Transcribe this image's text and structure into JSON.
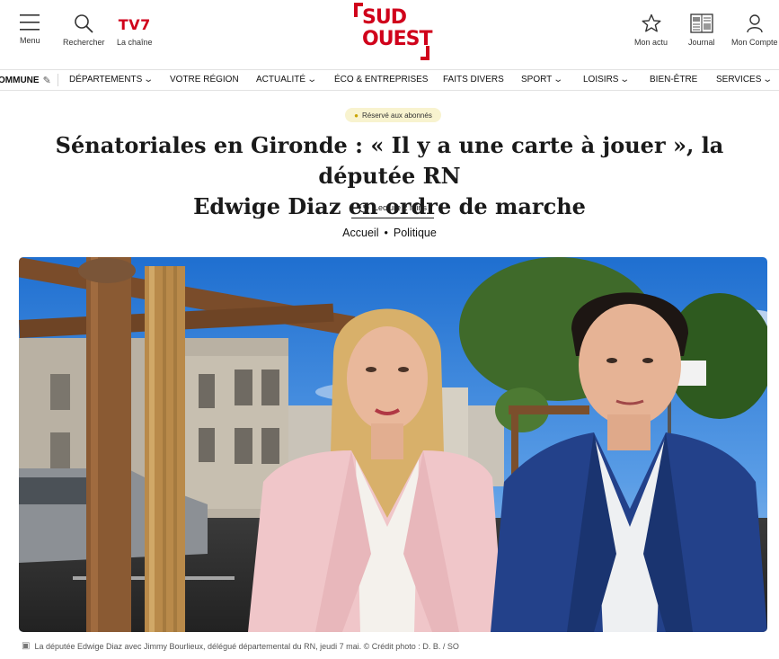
{
  "header": {
    "menu_label": "Menu",
    "search_label": "Rechercher",
    "channel_logo": "TV7",
    "channel_label": "La chaîne",
    "brand_line1": "SUD",
    "brand_line2": "OUEST",
    "brand_color": "#d0021b",
    "mon_actu_label": "Mon actu",
    "journal_label": "Journal",
    "compte_label": "Mon Compte"
  },
  "nav": {
    "items": [
      {
        "label": "OMMUNE",
        "has_chevron": false
      },
      {
        "label": "DÉPARTEMENTS",
        "has_chevron": true
      },
      {
        "label": "VOTRE RÉGION",
        "has_chevron": false
      },
      {
        "label": "ACTUALITÉ",
        "has_chevron": true
      },
      {
        "label": "ÉCO & ENTREPRISES",
        "has_chevron": false
      },
      {
        "label": "FAITS DIVERS",
        "has_chevron": false
      },
      {
        "label": "SPORT",
        "has_chevron": true
      },
      {
        "label": "LOISIRS",
        "has_chevron": true
      },
      {
        "label": "BIEN-ÊTRE",
        "has_chevron": false
      },
      {
        "label": "SERVICES",
        "has_chevron": true
      }
    ]
  },
  "article": {
    "badge": "Réservé aux abonnés",
    "title_line1": "Sénatoriales en Gironde : « Il y a une carte à jouer », la députée RN",
    "title_line2": "Edwige Diaz en ordre de marche",
    "read_time": "Lecture 2 mins",
    "breadcrumb_home": "Accueil",
    "breadcrumb_sep": "•",
    "breadcrumb_section": "Politique",
    "caption": "La députée Edwige Diaz avec Jimmy Bourlieux, délégué départemental du RN, jeudi 7 mai. © Crédit photo : D. B. / SO"
  },
  "icons": {
    "menu": "hamburger-icon",
    "search": "magnifier-icon",
    "mon_actu": "star-icon",
    "journal": "newspaper-icon",
    "compte": "user-icon",
    "read_time": "clock-icon",
    "caption": "camera-icon",
    "badge": "lock-icon"
  }
}
